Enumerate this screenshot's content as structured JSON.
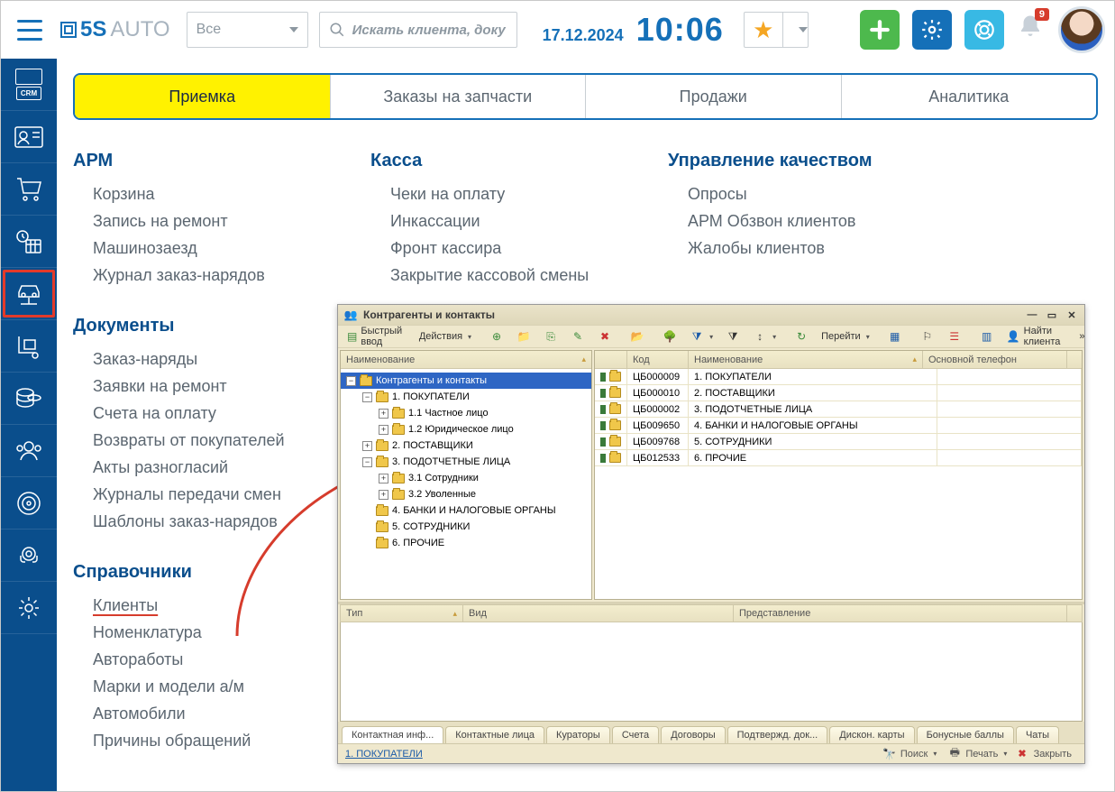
{
  "header": {
    "logo_brand": "5S",
    "logo_rest": "AUTO",
    "selector_value": "Все",
    "search_placeholder": "Искать клиента, доку",
    "date": "17.12.2024",
    "time": "10:06",
    "notifications_count": "9"
  },
  "tabs": [
    "Приемка",
    "Заказы на запчасти",
    "Продажи",
    "Аналитика"
  ],
  "active_tab": 0,
  "columns": [
    {
      "title": "АРМ",
      "items": [
        "Корзина",
        "Запись на ремонт",
        "Машинозаезд",
        "Журнал заказ-нарядов"
      ]
    },
    {
      "title": "Касса",
      "items": [
        "Чеки на оплату",
        "Инкассации",
        "Фронт кассира",
        "Закрытие кассовой смены"
      ]
    },
    {
      "title": "Управление качеством",
      "items": [
        "Опросы",
        "АРМ Обзвон клиентов",
        "Жалобы клиентов"
      ]
    },
    {
      "title": "Документы",
      "items": [
        "Заказ-наряды",
        "Заявки на ремонт",
        "Счета на оплату",
        "Возвраты от покупателей",
        "Акты разногласий",
        "Журналы передачи смен",
        "Шаблоны заказ-нарядов"
      ]
    },
    {
      "title": "Справочники",
      "items": [
        "Клиенты",
        "Номенклатура",
        "Автоработы",
        "Марки и модели а/м",
        "Автомобили",
        "Причины обращений"
      ]
    }
  ],
  "window": {
    "title": "Контрагенты и контакты",
    "toolbar": {
      "quick": "Быстрый ввод",
      "actions": "Действия",
      "go": "Перейти",
      "find_client": "Найти клиента"
    },
    "tree_header": "Наименование",
    "tree": [
      {
        "level": 0,
        "exp": "-",
        "label": "Контрагенты и контакты",
        "sel": true
      },
      {
        "level": 1,
        "exp": "-",
        "label": "1. ПОКУПАТЕЛИ"
      },
      {
        "level": 2,
        "exp": "+",
        "label": "1.1 Частное лицо"
      },
      {
        "level": 2,
        "exp": "+",
        "label": "1.2 Юридическое лицо"
      },
      {
        "level": 1,
        "exp": "+",
        "label": "2. ПОСТАВЩИКИ"
      },
      {
        "level": 1,
        "exp": "-",
        "label": "3. ПОДОТЧЕТНЫЕ ЛИЦА"
      },
      {
        "level": 2,
        "exp": "+",
        "label": "3.1 Сотрудники"
      },
      {
        "level": 2,
        "exp": "+",
        "label": "3.2 Уволенные"
      },
      {
        "level": 1,
        "exp": "",
        "label": "4. БАНКИ И НАЛОГОВЫЕ ОРГАНЫ"
      },
      {
        "level": 1,
        "exp": "",
        "label": "5. СОТРУДНИКИ"
      },
      {
        "level": 1,
        "exp": "",
        "label": "6. ПРОЧИЕ"
      }
    ],
    "grid_headers": {
      "code": "Код",
      "name": "Наименование",
      "phone": "Основной телефон"
    },
    "grid_rows": [
      {
        "code": "ЦБ000009",
        "name": "1. ПОКУПАТЕЛИ"
      },
      {
        "code": "ЦБ000010",
        "name": "2. ПОСТАВЩИКИ"
      },
      {
        "code": "ЦБ000002",
        "name": "3. ПОДОТЧЕТНЫЕ ЛИЦА"
      },
      {
        "code": "ЦБ009650",
        "name": "4. БАНКИ И НАЛОГОВЫЕ ОРГАНЫ"
      },
      {
        "code": "ЦБ009768",
        "name": "5. СОТРУДНИКИ"
      },
      {
        "code": "ЦБ012533",
        "name": "6. ПРОЧИЕ"
      }
    ],
    "bottom_headers": {
      "type": "Тип",
      "kind": "Вид",
      "rep": "Представление"
    },
    "bottom_tabs": [
      "Контактная инф...",
      "Контактные лица",
      "Кураторы",
      "Счета",
      "Договоры",
      "Подтвержд. док...",
      "Дискон. карты",
      "Бонусные баллы",
      "Чаты"
    ],
    "active_bottom_tab": 0,
    "status_left": "1. ПОКУПАТЕЛИ",
    "status_search": "Поиск",
    "status_print": "Печать",
    "status_close": "Закрыть"
  }
}
